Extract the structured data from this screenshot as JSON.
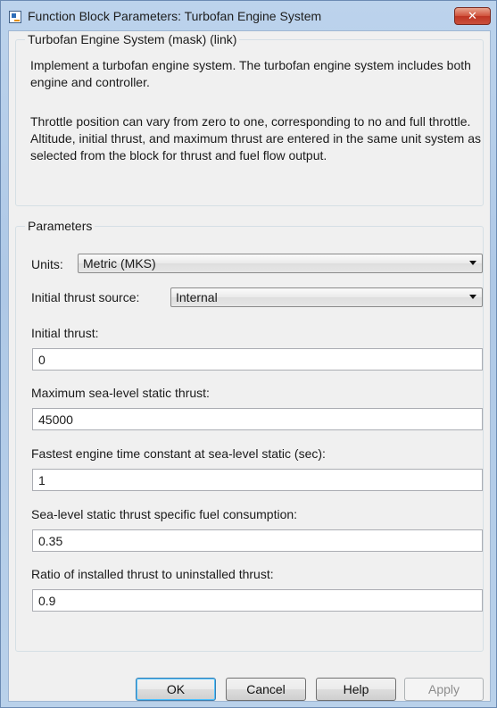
{
  "window": {
    "title": "Function Block Parameters: Turbofan Engine System",
    "close_label": "✕"
  },
  "mask": {
    "legend": "Turbofan Engine System (mask) (link)",
    "description_1": "Implement a turbofan engine system. The turbofan engine system includes both engine and controller.",
    "description_2": "Throttle position can vary from zero to one, corresponding to no and full throttle.  Altitude, initial thrust, and maximum thrust are entered in the same unit system as selected from the block for thrust and fuel flow output."
  },
  "parameters": {
    "legend": "Parameters",
    "units": {
      "label": "Units:",
      "value": "Metric (MKS)"
    },
    "initial_thrust_source": {
      "label": "Initial thrust source:",
      "value": "Internal"
    },
    "initial_thrust": {
      "label": "Initial thrust:",
      "value": "0"
    },
    "max_thrust": {
      "label": "Maximum sea-level static thrust:",
      "value": "45000"
    },
    "time_constant": {
      "label": "Fastest engine time constant at sea-level static (sec):",
      "value": "1"
    },
    "tsfc": {
      "label": "Sea-level static thrust specific fuel consumption:",
      "value": "0.35"
    },
    "installed_ratio": {
      "label": "Ratio of installed thrust to uninstalled thrust:",
      "value": "0.9"
    }
  },
  "buttons": {
    "ok": "OK",
    "cancel": "Cancel",
    "help": "Help",
    "apply": "Apply"
  },
  "colors": {
    "close_button": "#c9503c",
    "default_button_border": "#3c7fb1"
  }
}
